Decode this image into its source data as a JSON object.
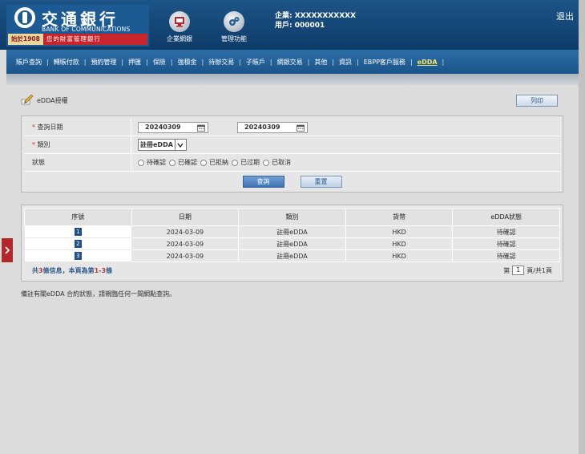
{
  "header": {
    "logo_cn": "交通銀行",
    "logo_en": "BANK OF COMMUNICATIONS",
    "slogan_year": "始於1908",
    "slogan_text": "您的財富管理銀行",
    "nav": [
      {
        "label": "企業網銀",
        "icon": "monitor-icon"
      },
      {
        "label": "管理功能",
        "icon": "gear-icon"
      }
    ],
    "enterprise": "企業: XXXXXXXXXXX",
    "user": "用戶: 000001",
    "logout": "退出"
  },
  "menu": {
    "items": [
      "賬戶查詢",
      "轉賬付款",
      "預約管理",
      "押匯",
      "保險",
      "強積金",
      "待辦交易",
      "子賬戶",
      "網銀交易",
      "其他",
      "資訊",
      "EBPP客戶服務",
      "eDDA"
    ],
    "active": "eDDA",
    "separator": "|"
  },
  "page": {
    "title": "eDDA授權",
    "print_label": "列印"
  },
  "form": {
    "date_label": "查詢日期",
    "required_mark": "*",
    "date_from": "20240309",
    "date_to": "20240309",
    "type_label": "類別",
    "type_value": "註冊eDDA",
    "status_label": "狀態",
    "status_options": [
      "待確認",
      "已確認",
      "已拒納",
      "已过期",
      "已取消"
    ],
    "query_label": "查詢",
    "reset_label": "重置"
  },
  "table": {
    "columns": [
      "序號",
      "日期",
      "類別",
      "貨幣",
      "eDDA狀態"
    ],
    "rows": [
      {
        "seq": "1",
        "date": "2024-03-09",
        "type": "註冊eDDA",
        "currency": "HKD",
        "status": "待確認"
      },
      {
        "seq": "2",
        "date": "2024-03-09",
        "type": "註冊eDDA",
        "currency": "HKD",
        "status": "待確認"
      },
      {
        "seq": "3",
        "date": "2024-03-09",
        "type": "註冊eDDA",
        "currency": "HKD",
        "status": "待確認"
      }
    ]
  },
  "summary": {
    "prefix": "共",
    "total": "3",
    "mid": "條信息，本頁為第",
    "from": "1",
    "dash": "-",
    "to": "3",
    "suffix": "條",
    "page_prefix": "第",
    "page_current": "1",
    "page_suffix": "頁/共1頁"
  },
  "note": "備註有關eDDA 合約狀態，請親臨任何一間網點查詢。",
  "colors": {
    "header_bg": "#0e3b68",
    "menu_bg": "#1a5488",
    "active_menu": "#f3e46a",
    "accent_red": "#c0392b",
    "page_bg": "#dcdcdc"
  }
}
